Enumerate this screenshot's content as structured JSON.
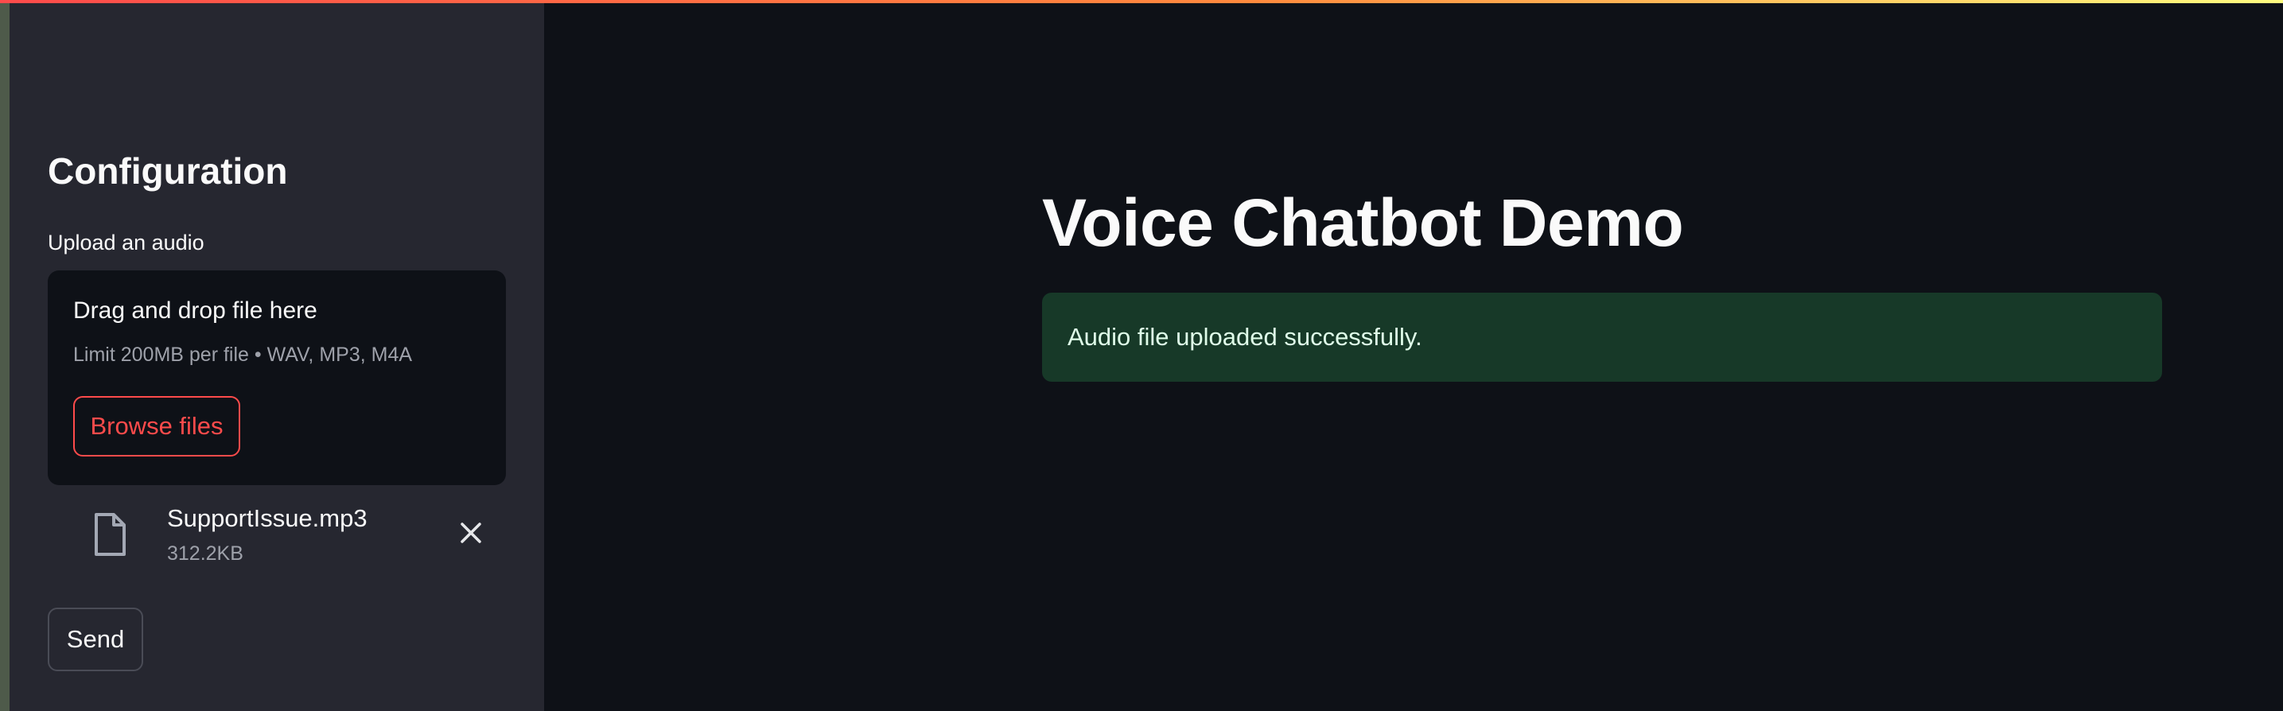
{
  "sidebar": {
    "title": "Configuration",
    "upload_label": "Upload an audio",
    "dropzone": {
      "title": "Drag and drop file here",
      "limit": "Limit 200MB per file • WAV, MP3, M4A",
      "browse_label": "Browse files"
    },
    "file": {
      "name": "SupportIssue.mp3",
      "size": "312.2KB",
      "icon": "file-icon",
      "remove_icon": "close-icon"
    },
    "send_label": "Send"
  },
  "main": {
    "title": "Voice Chatbot Demo",
    "alert": {
      "text": "Audio file uploaded successfully.",
      "type": "success"
    }
  },
  "colors": {
    "accent": "#ff4b4b",
    "sidebar_bg": "#262730",
    "main_bg": "#0e1117",
    "success_bg": "#173928",
    "success_text": "#dffde9"
  }
}
